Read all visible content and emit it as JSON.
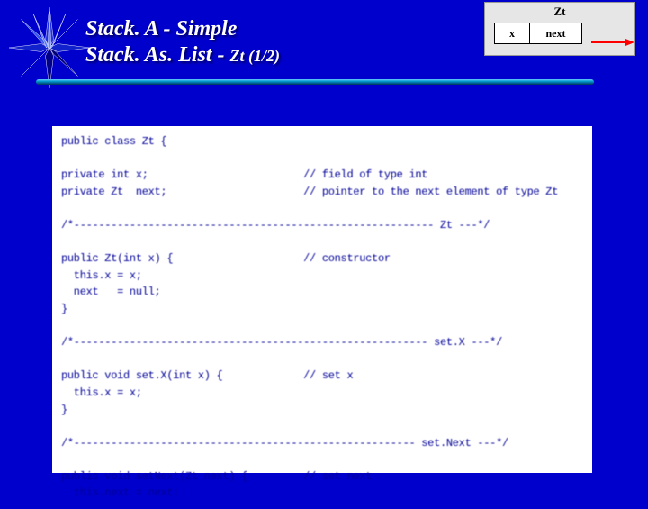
{
  "title": {
    "line1": "Stack. A  -  Simple",
    "line2_a": "Stack. As. List  -  ",
    "line2_b": "Zt  (1/2)"
  },
  "diagram": {
    "label": "Zt",
    "cell_x": "x",
    "cell_next": "next"
  },
  "code": "public class Zt {\n\nprivate int x;                         // field of type int\nprivate Zt  next;                      // pointer to the next element of type Zt\n\n/*---------------------------------------------------------- Zt ---*/\n\npublic Zt(int x) {                     // constructor\n  this.x = x;\n  next   = null;\n}\n\n/*--------------------------------------------------------- set.X ---*/\n\npublic void set.X(int x) {             // set x\n  this.x = x;\n}\n\n/*------------------------------------------------------- set.Next ---*/\n\npublic void setNext(Zt next) {         // set next\n  this.next = next;\n"
}
